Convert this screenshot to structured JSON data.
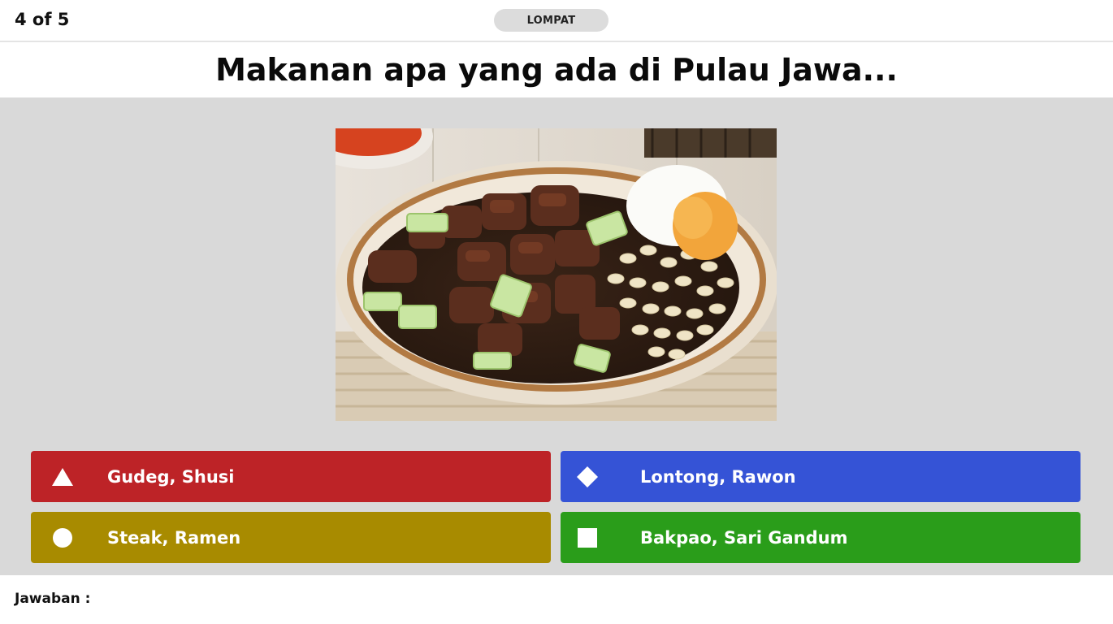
{
  "header": {
    "counter": "4 of 5",
    "skip_label": "LOMPAT"
  },
  "question": {
    "text": "Makanan apa yang ada di Pulau Jawa..."
  },
  "image": {
    "description_icon": "food-photo"
  },
  "answers": [
    {
      "label": "Gudeg, Shusi",
      "shape": "triangle",
      "color": "#bd2327"
    },
    {
      "label": "Lontong, Rawon",
      "shape": "diamond",
      "color": "#3553d6"
    },
    {
      "label": "Steak, Ramen",
      "shape": "circle",
      "color": "#a88b00"
    },
    {
      "label": "Bakpao, Sari Gandum",
      "shape": "square",
      "color": "#2a9d1a"
    }
  ],
  "footer": {
    "answer_label": "Jawaban :"
  }
}
